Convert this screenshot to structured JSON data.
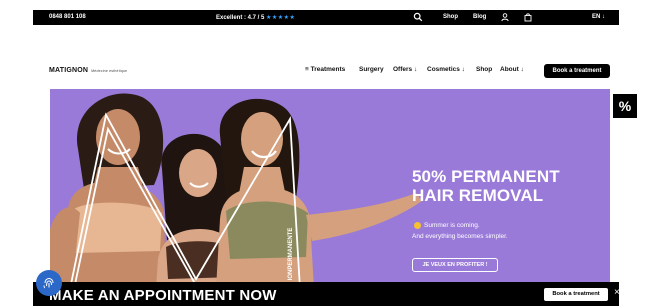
{
  "topbar": {
    "phone": "0848 801 108",
    "rating_text": "Excellent : 4.7 / 5",
    "stars": "★★★★★",
    "shop": "Shop",
    "blog": "Blog",
    "lang": "EN ↓"
  },
  "brand": {
    "name": "MATIGNON",
    "tagline": "Médecine esthétique"
  },
  "nav": {
    "items": [
      {
        "label": "≡ Treatments"
      },
      {
        "label": "Surgery"
      },
      {
        "label": "Offers ↓"
      },
      {
        "label": "Cosmetics ↓"
      },
      {
        "label": "Shop"
      },
      {
        "label": "About ↓"
      }
    ],
    "book_label": "Book a treatment"
  },
  "hero": {
    "headline_line1": "50% PERMANENT",
    "headline_line2": "HAIR REMOVAL",
    "sub1": "Summer is coming.",
    "sub2": "And everything becomes simpler.",
    "cta": "JE VEUX EN PROFITER !",
    "vertical": "IONPERMANENTE",
    "bg_color": "#9a7ad8"
  },
  "side_tile": "%",
  "appointment": {
    "title": "MAKE AN APPOINTMENT NOW",
    "button": "Book a treatment",
    "close": "×"
  },
  "icons": [
    "search-icon",
    "user-icon",
    "bag-icon",
    "sun-icon",
    "fingerprint-icon",
    "close-icon"
  ]
}
